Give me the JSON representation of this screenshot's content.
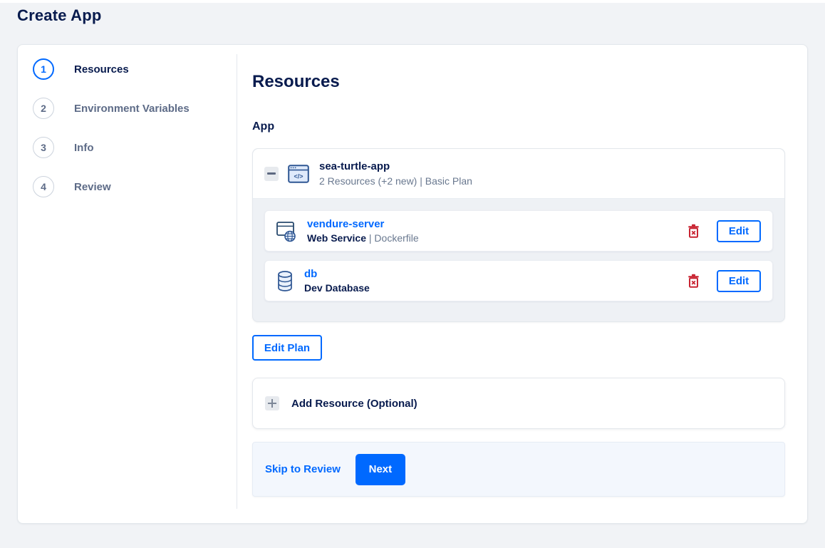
{
  "page": {
    "title": "Create App"
  },
  "colors": {
    "accent_blue": "#0069ff",
    "navy_text": "#081b4e",
    "gray_text": "#69788f",
    "danger_red": "#c92432",
    "page_background": "#f1f3f6",
    "panel_gray": "#eef1f5",
    "footer_blue": "#f3f7fd"
  },
  "stepper": {
    "steps": [
      {
        "number": "1",
        "label": "Resources",
        "active": true
      },
      {
        "number": "2",
        "label": "Environment Variables",
        "active": false
      },
      {
        "number": "3",
        "label": "Info",
        "active": false
      },
      {
        "number": "4",
        "label": "Review",
        "active": false
      }
    ]
  },
  "main": {
    "heading": "Resources",
    "section_label": "App",
    "app_card": {
      "collapse_icon": "minus-icon",
      "app_icon": "app-window-code-icon",
      "name": "sea-turtle-app",
      "summary": "2 Resources (+2 new) | Basic Plan",
      "resources": [
        {
          "icon": "web-service-globe-icon",
          "name": "vendure-server",
          "type": "Web Service",
          "detail": " | Dockerfile",
          "delete_icon": "trash-icon",
          "edit_label": "Edit"
        },
        {
          "icon": "database-icon",
          "name": "db",
          "type": "Dev Database",
          "detail": "",
          "delete_icon": "trash-icon",
          "edit_label": "Edit"
        }
      ]
    },
    "edit_plan_label": "Edit Plan",
    "add_resource": {
      "icon": "plus-icon",
      "label": "Add Resource (Optional)"
    },
    "footer": {
      "skip_label": "Skip to Review",
      "next_label": "Next"
    }
  }
}
